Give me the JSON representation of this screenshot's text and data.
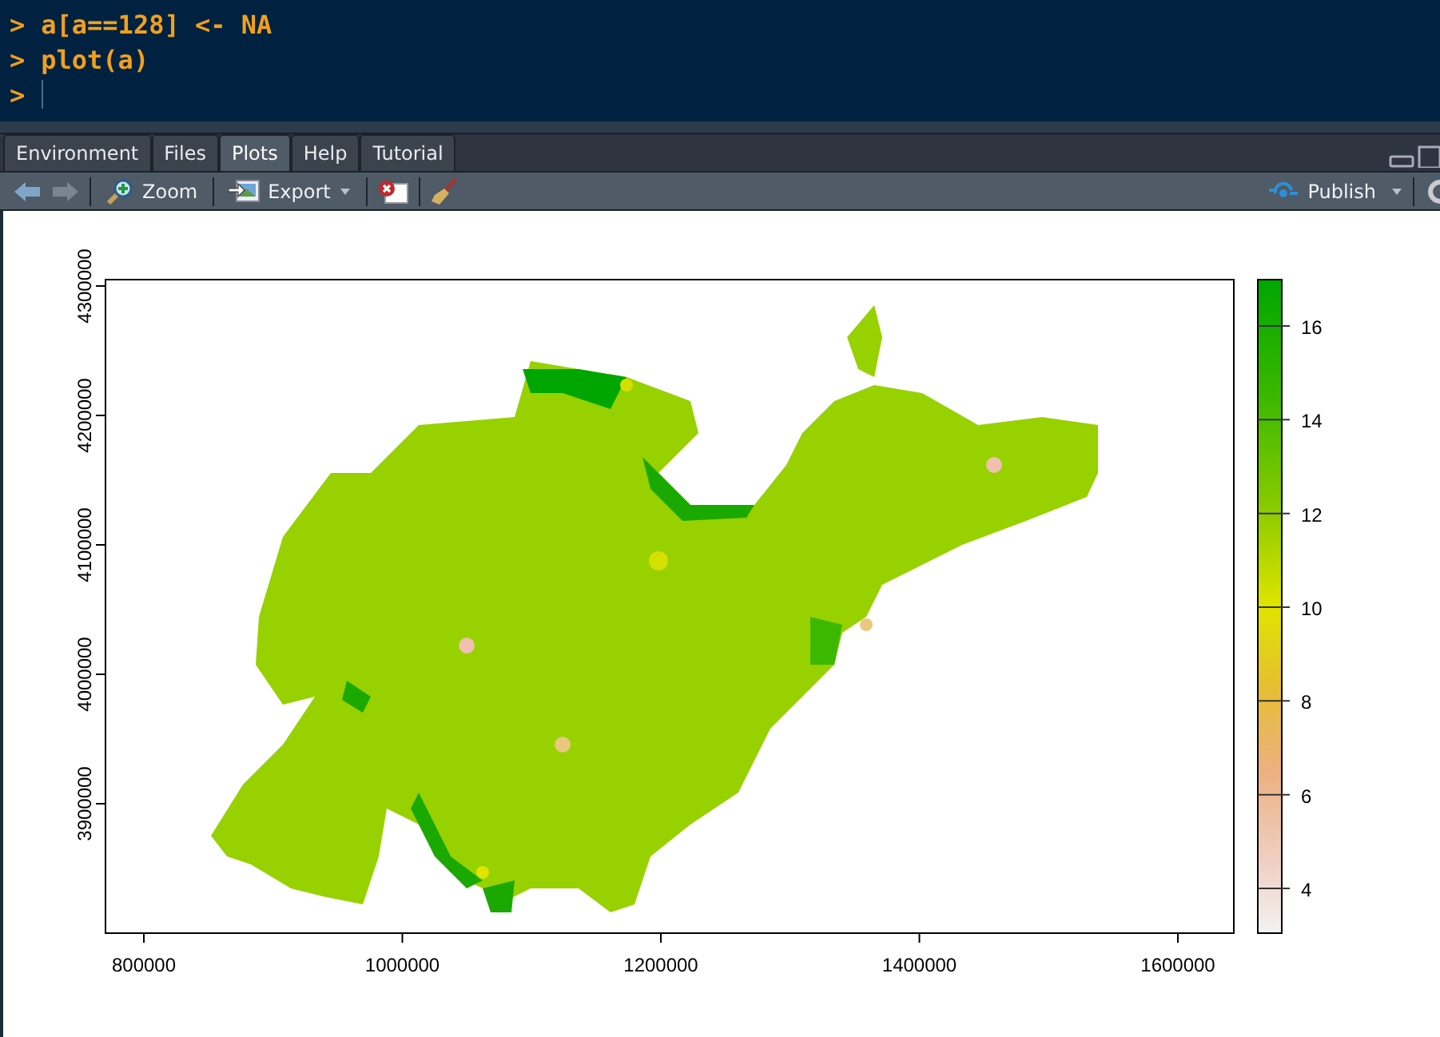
{
  "console": {
    "lines": [
      {
        "kind": "command",
        "prompt": ">",
        "code": "a[a==128] <- NA"
      },
      {
        "kind": "command",
        "prompt": ">",
        "code": "plot(a)"
      },
      {
        "kind": "input",
        "prompt": ">"
      }
    ]
  },
  "tabs": [
    {
      "label": "Environment",
      "selected": false
    },
    {
      "label": "Files",
      "selected": false
    },
    {
      "label": "Plots",
      "selected": true
    },
    {
      "label": "Help",
      "selected": false
    },
    {
      "label": "Tutorial",
      "selected": false
    }
  ],
  "toolbar": {
    "zoom": "Zoom",
    "export": "Export",
    "publish": "Publish"
  },
  "plot": {
    "x_ticks": [
      "800000",
      "1000000",
      "1200000",
      "1400000",
      "1600000"
    ],
    "y_ticks": [
      "4300000",
      "4200000",
      "4100000",
      "4000000",
      "3900000"
    ],
    "legend_ticks": [
      "16",
      "14",
      "12",
      "10",
      "8",
      "6",
      "4"
    ]
  }
}
